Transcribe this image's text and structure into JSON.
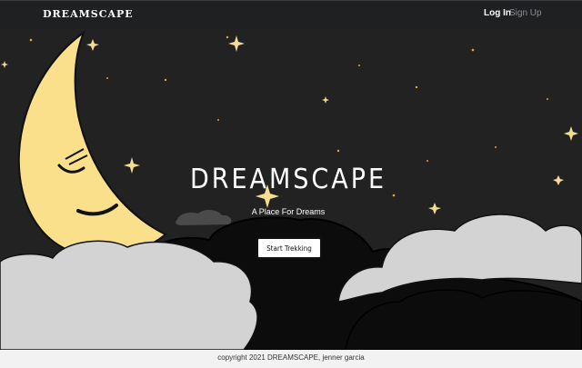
{
  "nav": {
    "brand": "DREAMSCAPE",
    "login_label": "Log In",
    "signup_label": "Sign Up"
  },
  "hero": {
    "title": "DREAMSCAPE",
    "subtitle": "A Place For Dreams",
    "cta_label": "Start Trekking"
  },
  "footer": {
    "copyright": "copyright 2021 DREAMSCAPE, jenner garcia"
  },
  "colors": {
    "sky": "#222222",
    "navbar": "#1e2022",
    "moon": "#fbe08c",
    "star": "#f5dc93",
    "cloud_light": "#d3d3d3",
    "cloud_dark": "#0c0c0c"
  }
}
